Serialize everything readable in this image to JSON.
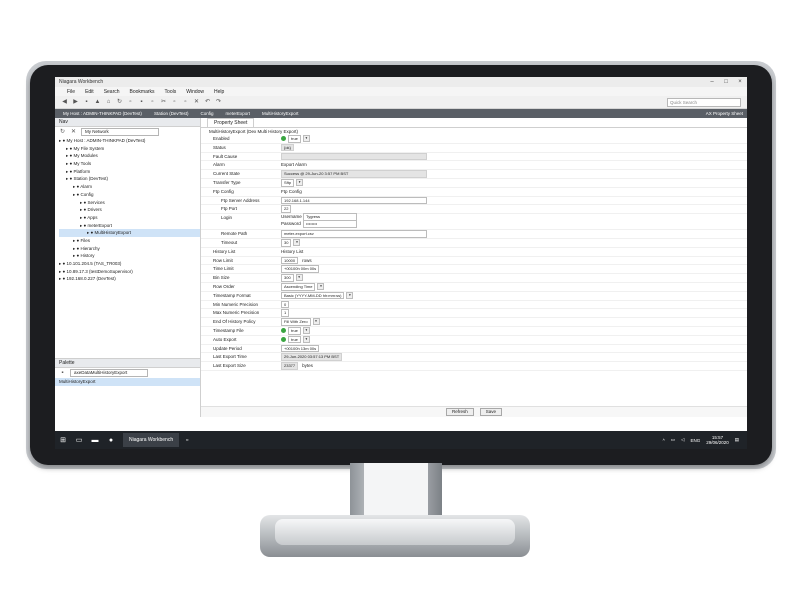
{
  "app": {
    "title": "Niagara Workbench",
    "menu": [
      "File",
      "Edit",
      "Search",
      "Bookmarks",
      "Tools",
      "Window",
      "Help"
    ],
    "search_placeholder": "Quick Search",
    "breadcrumbs": [
      "My Host : ADMIN-THINKPAD (DevTest)",
      "Station (DevTest)",
      "Config",
      "meterExport",
      "MultiHistoryExport"
    ],
    "view_selector": "AX Property Sheet"
  },
  "nav": {
    "title": "Nav",
    "network_selector": "My Network",
    "tree": [
      {
        "label": "My Host : ADMIN-THINKPAD (DevTest)",
        "indent": 0
      },
      {
        "label": "My File System",
        "indent": 1
      },
      {
        "label": "My Modules",
        "indent": 1
      },
      {
        "label": "My Tools",
        "indent": 1
      },
      {
        "label": "Platform",
        "indent": 1
      },
      {
        "label": "Station (DevTest)",
        "indent": 1
      },
      {
        "label": "Alarm",
        "indent": 2
      },
      {
        "label": "Config",
        "indent": 2
      },
      {
        "label": "Services",
        "indent": 3
      },
      {
        "label": "Drivers",
        "indent": 3
      },
      {
        "label": "Apps",
        "indent": 3
      },
      {
        "label": "meterExport",
        "indent": 3
      },
      {
        "label": "MultiHistoryExport",
        "indent": 4,
        "selected": true
      },
      {
        "label": "Files",
        "indent": 2
      },
      {
        "label": "Hierarchy",
        "indent": 2
      },
      {
        "label": "History",
        "indent": 2
      },
      {
        "label": "10.101.204.5 (TAS_TR003)",
        "indent": 0
      },
      {
        "label": "10.89.17.3 (testDemoSupervisor)",
        "indent": 0
      },
      {
        "label": "192.168.0.227 (DevTest)",
        "indent": 0
      }
    ]
  },
  "palette": {
    "title": "Palette",
    "selector": "axeDataMultiHistoryExport",
    "items": [
      "MultiHistoryExport"
    ]
  },
  "property_sheet": {
    "tab": "Property Sheet",
    "header": "MultiHistoryExport (Dex Multi History Export)",
    "rows": [
      {
        "label": "Enabled",
        "value": "true",
        "kind": "bool"
      },
      {
        "label": "Status",
        "value": "{ok}",
        "kind": "ro"
      },
      {
        "label": "Fault Cause",
        "value": "",
        "kind": "ro"
      },
      {
        "label": "Alarm",
        "value": "Export Alarm",
        "kind": "text"
      },
      {
        "label": "Current State",
        "value": "Success @ 29-Jun-20 3:57 PM BST",
        "kind": "ro"
      },
      {
        "label": "Transfer Type",
        "value": "Sftp",
        "kind": "select"
      },
      {
        "label": "Ftp Config",
        "value": "Ftp Config",
        "kind": "text"
      },
      {
        "label": "Ftp Server Address",
        "value": "192.168.1.144",
        "kind": "input",
        "indent": true
      },
      {
        "label": "Ftp Port",
        "value": "22",
        "kind": "input",
        "indent": true
      },
      {
        "label": "Login",
        "value": "",
        "kind": "login",
        "indent": true,
        "username_label": "Username",
        "username": "Tygress",
        "password_label": "Password",
        "password": "••••••••"
      },
      {
        "label": "Remote Path",
        "value": "meter-export.csv",
        "kind": "input",
        "indent": true
      },
      {
        "label": "Timeout",
        "value": "30",
        "kind": "select",
        "indent": true
      },
      {
        "label": "History List",
        "value": "History List",
        "kind": "text"
      },
      {
        "label": "Row Limit",
        "value": "10000",
        "unit": "rows",
        "kind": "input"
      },
      {
        "label": "Time Limit",
        "value": "+00100h 00m 00s",
        "kind": "input"
      },
      {
        "label": "Bin Size",
        "value": "300",
        "kind": "select"
      },
      {
        "label": "Row Order",
        "value": "Ascending Time",
        "kind": "select"
      },
      {
        "label": "Timestamp Format",
        "value": "Basic (YYYY-MM-DD hh:mm:ss)",
        "kind": "select"
      },
      {
        "label": "Min Numeric Precision",
        "value": "0",
        "kind": "input"
      },
      {
        "label": "Max Numeric Precision",
        "value": "1",
        "kind": "input"
      },
      {
        "label": "End Of History Policy",
        "value": "Fill With Zero",
        "kind": "select"
      },
      {
        "label": "Timestamp File",
        "value": "true",
        "kind": "bool"
      },
      {
        "label": "Auto Export",
        "value": "true",
        "kind": "bool"
      },
      {
        "label": "Update Period",
        "value": "+00100h 13m 00s",
        "kind": "input"
      },
      {
        "label": "Last Export Time",
        "value": "29-Jun-2020 03:57:13 PM BST",
        "kind": "ro"
      },
      {
        "label": "Last Export Size",
        "value": "23377",
        "unit": "bytes",
        "kind": "ro"
      }
    ],
    "refresh_label": "Refresh",
    "save_label": "Save"
  },
  "taskbar": {
    "active_app": "Niagara Workbench",
    "lang": "ENG",
    "time": "15:57",
    "date": "29/06/2020"
  }
}
